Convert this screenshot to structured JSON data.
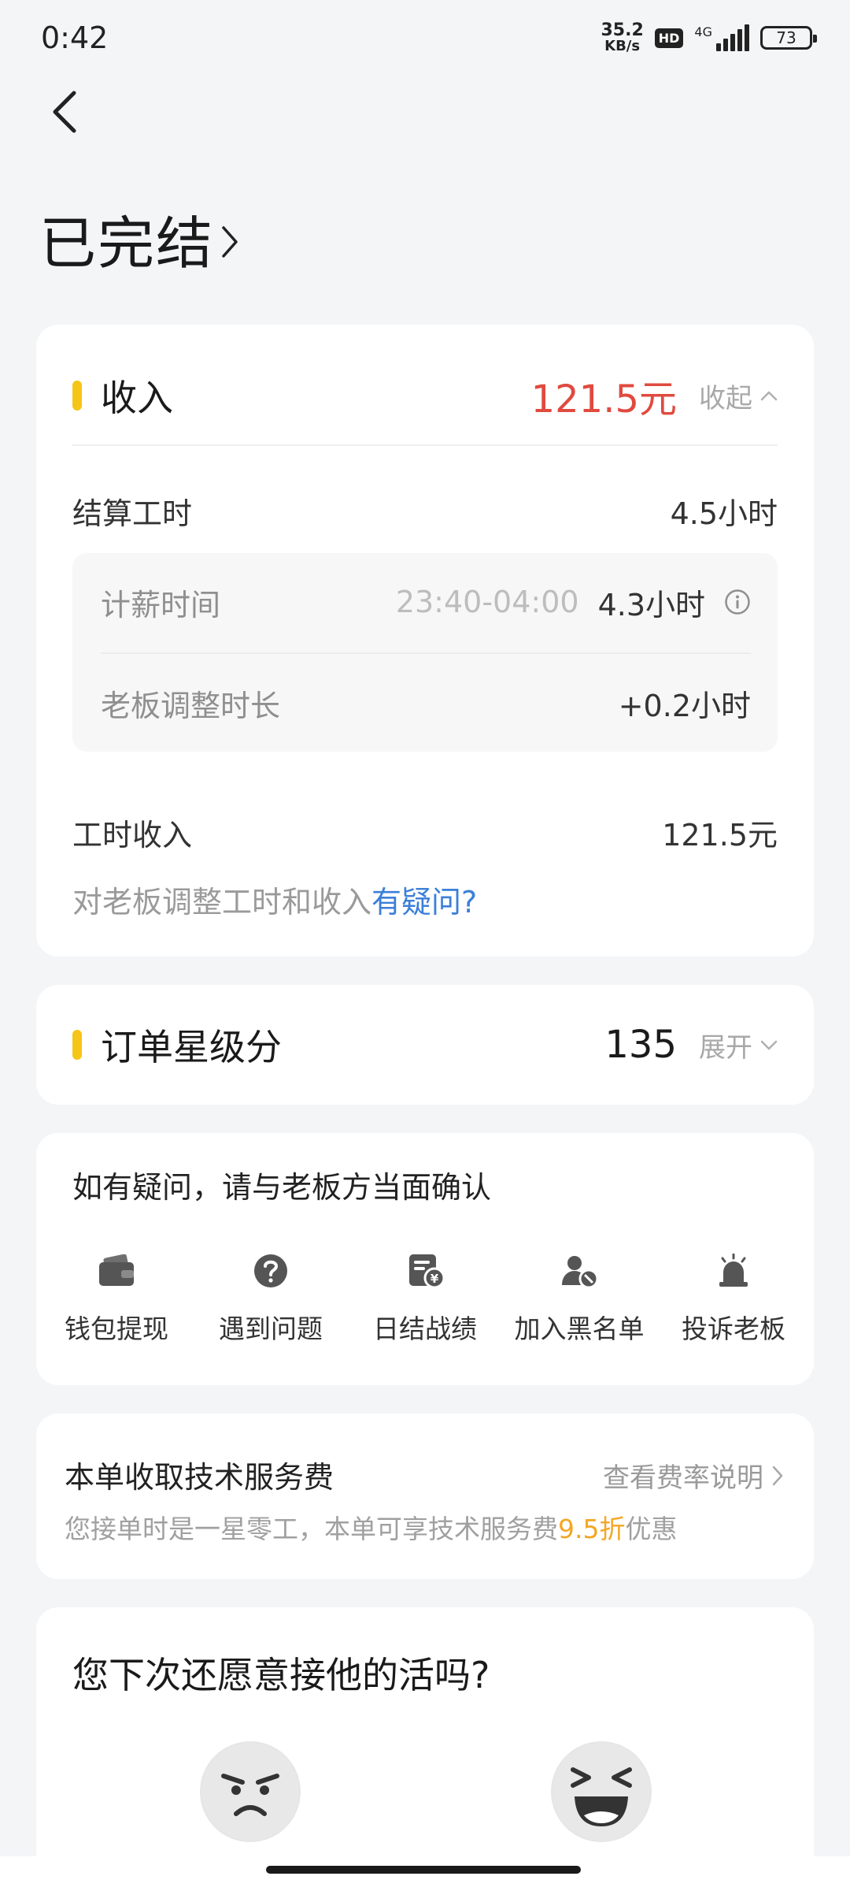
{
  "status_bar": {
    "time": "0:42",
    "net_speed_value": "35.2",
    "net_speed_unit": "KB/s",
    "hd": "HD",
    "network": "4G",
    "battery": "73"
  },
  "header": {
    "title": "已完结"
  },
  "income": {
    "title": "收入",
    "amount": "121.5元",
    "toggle_label": "收起",
    "settled_hours_label": "结算工时",
    "settled_hours_value": "4.5小时",
    "pay_time_label": "计薪时间",
    "pay_time_range": "23:40-04:00",
    "pay_time_hours": "4.3小时",
    "adjust_label": "老板调整时长",
    "adjust_value": "+0.2小时",
    "hour_income_label": "工时收入",
    "hour_income_value": "121.5元",
    "question_text": "对老板调整工时和收入",
    "question_link": "有疑问?"
  },
  "stars": {
    "title": "订单星级分",
    "score": "135",
    "toggle_label": "展开"
  },
  "actions": {
    "title": "如有疑问，请与老板方当面确认",
    "items": [
      {
        "label": "钱包提现",
        "icon": "wallet-icon"
      },
      {
        "label": "遇到问题",
        "icon": "question-icon"
      },
      {
        "label": "日结战绩",
        "icon": "daily-record-icon"
      },
      {
        "label": "加入黑名单",
        "icon": "blacklist-icon"
      },
      {
        "label": "投诉老板",
        "icon": "alarm-icon"
      }
    ]
  },
  "fee": {
    "title": "本单收取技术服务费",
    "link": "查看费率说明",
    "desc_before": "您接单时是一星零工，本单可享技术服务费",
    "desc_highlight": "9.5折",
    "desc_after": "优惠"
  },
  "rehire": {
    "question": "您下次还愿意接他的活吗?"
  },
  "colors": {
    "accent": "#f5c518",
    "amount_red": "#e04a3f",
    "link_blue": "#3b7fd9",
    "highlight_orange": "#f5a623"
  }
}
